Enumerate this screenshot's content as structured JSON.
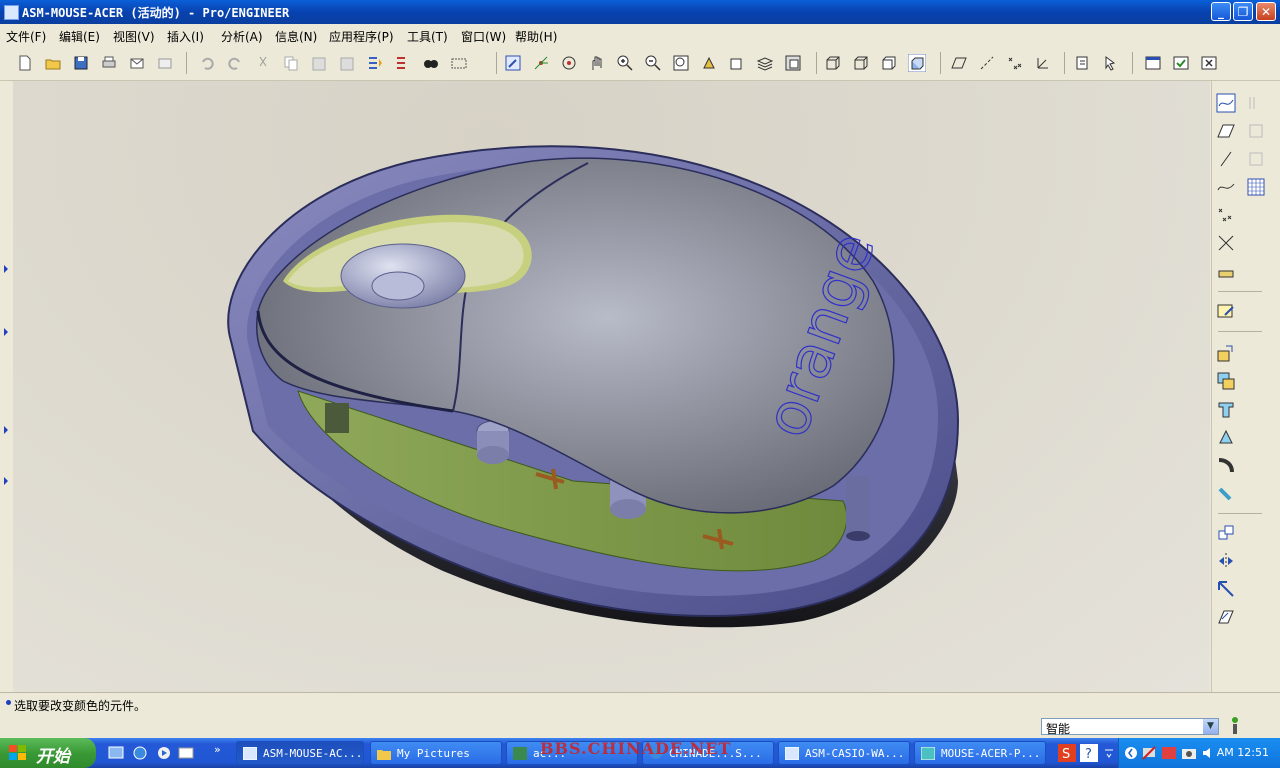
{
  "window": {
    "title": "ASM-MOUSE-ACER (活动的) - Pro/ENGINEER",
    "minimize": "_",
    "maximize": "❐",
    "close": "✕"
  },
  "menu": [
    "文件(F)",
    "编辑(E)",
    "视图(V)",
    "插入(I)",
    "分析(A)",
    "信息(N)",
    "应用程序(P)",
    "工具(T)",
    "窗口(W)",
    "帮助(H)"
  ],
  "toolbar_icons": [
    "new",
    "open",
    "save",
    "print",
    "email",
    "email-link",
    "undo",
    "redo",
    "cut",
    "copy",
    "paste",
    "paste-special",
    "regenerate",
    "regen-manager",
    "find",
    "select-box",
    "sketch-pencil",
    "spin-center",
    "orient-mode",
    "pan-hand",
    "zoom-in",
    "zoom-out",
    "refit",
    "reorient",
    "saved-views",
    "layers",
    "view-manager",
    "wireframe",
    "hidden-line",
    "no-hidden",
    "shading",
    "datum-planes",
    "datum-axes",
    "datum-points",
    "coord-sys",
    "annotation",
    "help-context",
    "new-window",
    "activate-window",
    "close-window"
  ],
  "model_label": "orange",
  "right_toolbar_icons": [
    "sketch-datum-curve",
    "datum-plane",
    "datum-axis",
    "datum-curve",
    "datum-point",
    "datum-csys",
    "analysis-feature",
    "sketch-tool",
    "insert-component",
    "create-component",
    "extrude",
    "revolve",
    "sweep",
    "hole",
    "round",
    "chamfer",
    "draft",
    "pattern",
    "mirror",
    "warp"
  ],
  "status_message": "选取要改变颜色的元件。",
  "selection_filter": "智能",
  "watermark": "BBS.CHINADE.NET",
  "taskbar": {
    "start": "开始",
    "tasks": [
      "ASM-MOUSE-AC...",
      "My Pictures",
      "ac...",
      "CHINADE...S...",
      "ASM-CASIO-WA...",
      "MOUSE-ACER-P..."
    ],
    "clock": "AM 12:51"
  },
  "colors": {
    "title_blue": "#0842b0",
    "menu_bg": "#ece9d8",
    "accent_green": "#3a9a36"
  }
}
